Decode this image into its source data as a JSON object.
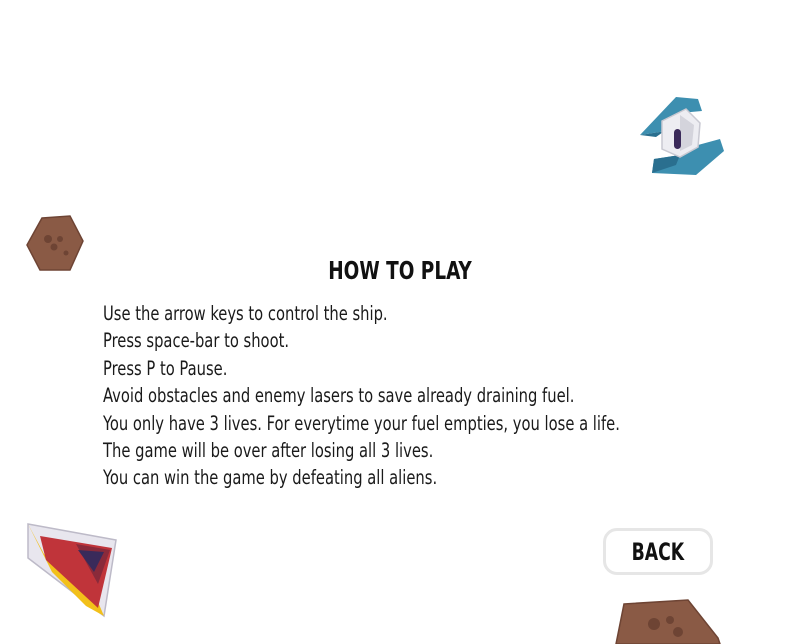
{
  "screen": {
    "title": "HOW TO PLAY",
    "instructions": [
      "Use the arrow keys to control the ship.",
      "Press space-bar to shoot.",
      "Press P to Pause.",
      "Avoid obstacles and enemy lasers to save already draining fuel.",
      "You only have 3 lives. For everytime your fuel empties, you lose a life.",
      "The game will be over after losing all 3 lives.",
      "You can win the game by defeating all aliens."
    ],
    "back_label": "BACK"
  },
  "sprites": {
    "alien_ship": {
      "icon": "alien-ship-icon",
      "colors": {
        "wing": "#3d8fb0",
        "wing_dark": "#2a6f8f",
        "body": "#e9e9ee",
        "window": "#3b2a5a"
      }
    },
    "asteroid_small": {
      "icon": "asteroid-icon",
      "colors": {
        "fill": "#8a5a45",
        "spot": "#6e4434"
      }
    },
    "player_ship": {
      "icon": "player-ship-icon",
      "colors": {
        "hull": "#c0343a",
        "edge": "#e8e6ee",
        "trim": "#f2c01a",
        "cockpit": "#3a2a5a"
      }
    },
    "asteroid_large": {
      "icon": "asteroid-icon",
      "colors": {
        "fill": "#8a5a45",
        "spot": "#6e4434"
      }
    }
  }
}
